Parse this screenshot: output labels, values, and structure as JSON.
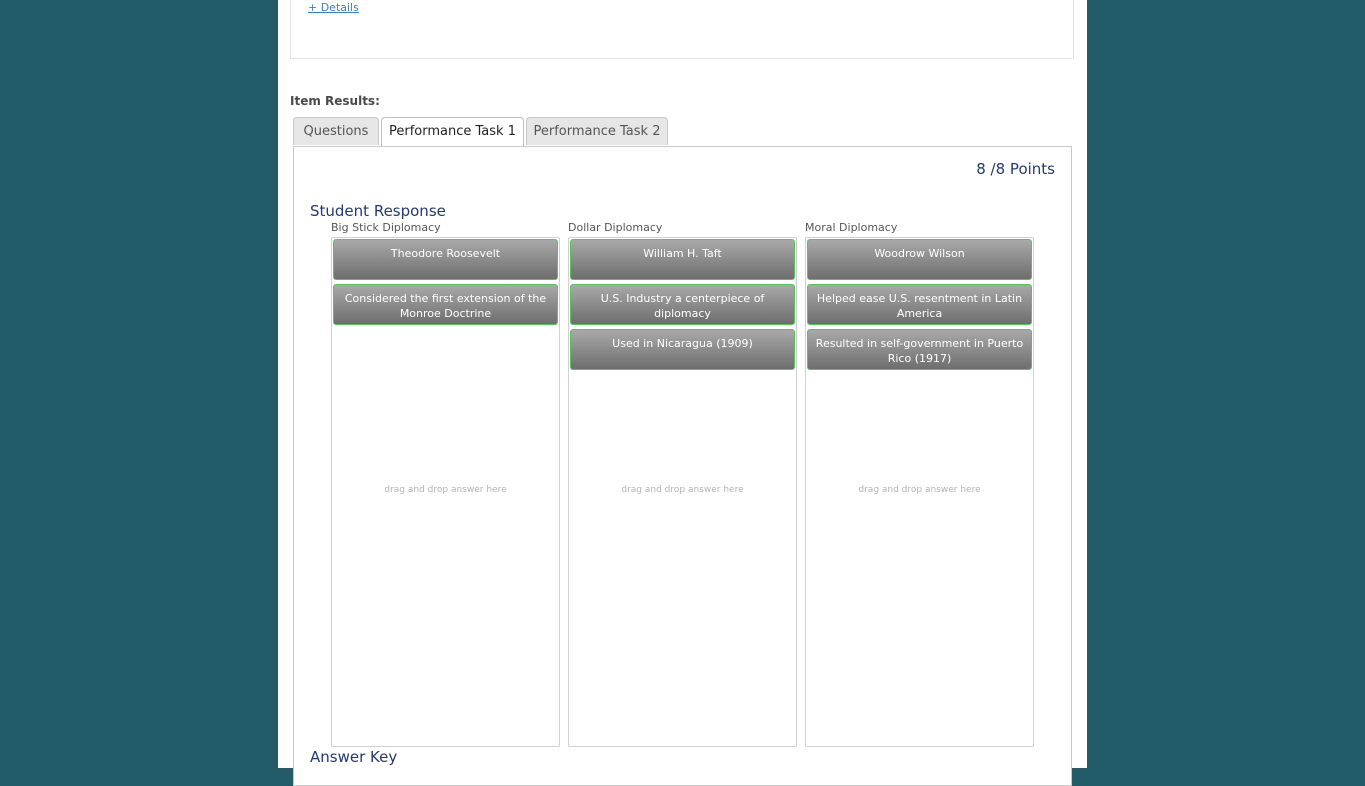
{
  "details": {
    "link_label": "+ Details"
  },
  "item_results_label": "Item Results:",
  "tabs": [
    {
      "label": "Questions"
    },
    {
      "label": "Performance Task 1"
    },
    {
      "label": "Performance Task 2"
    }
  ],
  "active_tab": "Performance Task 1",
  "points": "8 /8 Points",
  "student_response_title": "Student Response",
  "answer_key_title": "Answer Key",
  "columns": [
    {
      "label": "Big Stick Diplomacy",
      "cards": [
        "Theodore Roosevelt",
        "Considered the first extension of the Monroe Doctrine"
      ],
      "hint": "drag and drop answer here"
    },
    {
      "label": "Dollar Diplomacy",
      "cards": [
        "William H. Taft",
        "U.S. Industry a centerpiece of diplomacy",
        "Used in Nicaragua (1909)"
      ],
      "hint": "drag and drop answer here"
    },
    {
      "label": "Moral Diplomacy",
      "cards": [
        "Woodrow Wilson",
        "Helped ease U.S. resentment in Latin America",
        "Resulted in self-government in Puerto Rico (1917)"
      ],
      "hint": "drag and drop answer here"
    }
  ],
  "colors": {
    "page_background": "#225c68",
    "heading_blue": "#233a70",
    "card_border_correct": "#56c45d",
    "link": "#3a7fbf"
  }
}
